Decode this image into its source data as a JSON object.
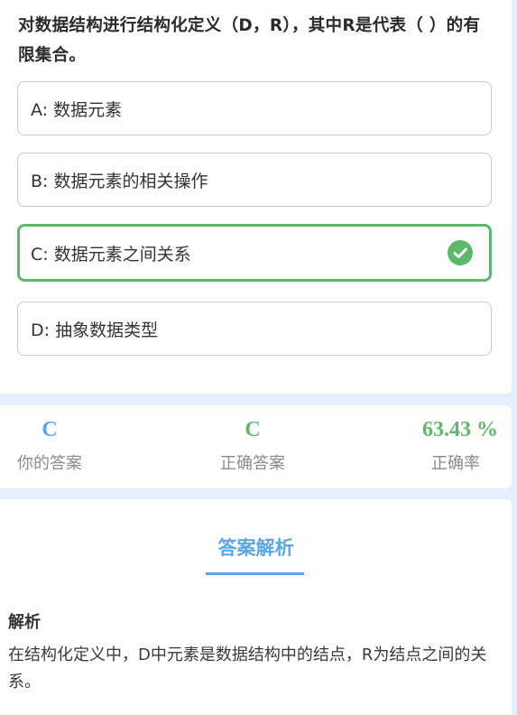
{
  "question": {
    "text": "对数据结构进行结构化定义（D，R），其中R是代表（ ）的有限集合。"
  },
  "options": [
    {
      "label": "A: 数据元素",
      "correct": false
    },
    {
      "label": "B: 数据元素的相关操作",
      "correct": false
    },
    {
      "label": "C: 数据元素之间关系",
      "correct": true
    },
    {
      "label": "D: 抽象数据类型",
      "correct": false
    }
  ],
  "stats": {
    "your_answer": {
      "value": "C",
      "label": "你的答案",
      "color": "#5aa6e8"
    },
    "correct_answer": {
      "value": "C",
      "label": "正确答案",
      "color": "#5cb96b"
    },
    "accuracy": {
      "value": "63.43 %",
      "label": "正确率",
      "color": "#5cb96b"
    }
  },
  "analysis": {
    "title": "答案解析",
    "heading": "解析",
    "body": "在结构化定义中，D中元素是数据结构中的结点，R为结点之间的关系。"
  },
  "colors": {
    "accent_blue": "#5aa6e8",
    "correct_green": "#5cb96b",
    "background": "#e3effb"
  }
}
